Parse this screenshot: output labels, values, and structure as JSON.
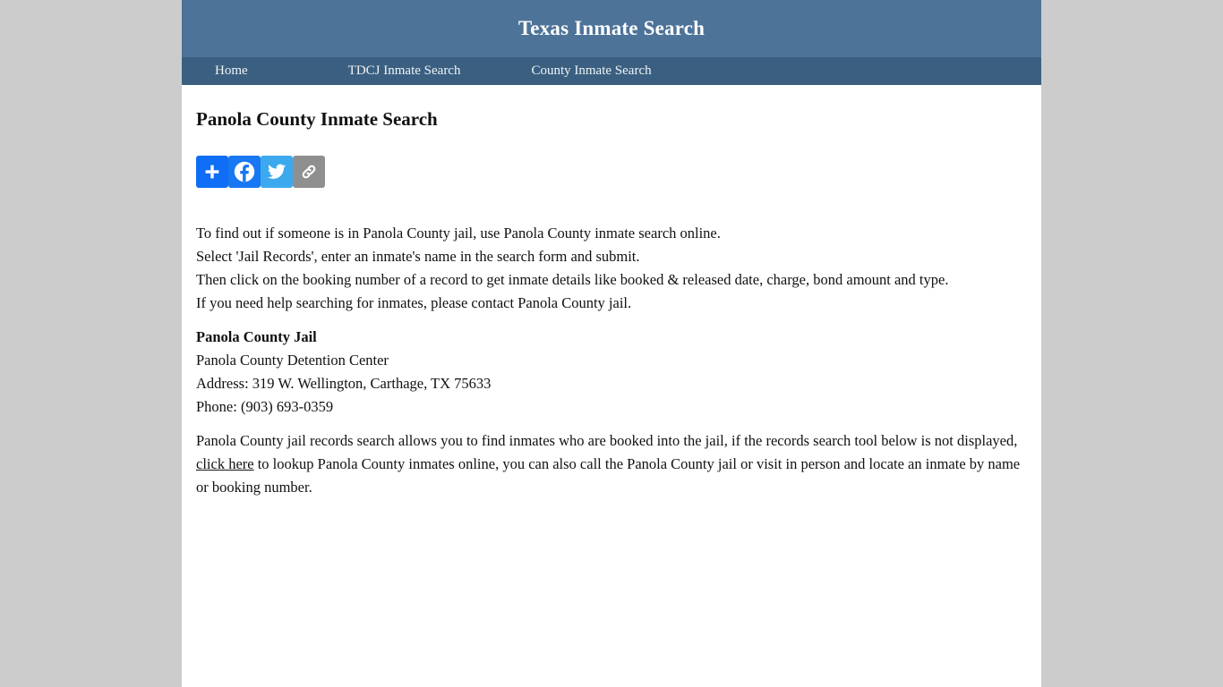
{
  "header": {
    "title": "Texas Inmate Search",
    "bg_color": "#4d7399"
  },
  "nav": {
    "bg_color": "#3b5f80",
    "items": [
      {
        "label": "Home"
      },
      {
        "label": "TDCJ Inmate Search"
      },
      {
        "label": "County Inmate Search"
      }
    ]
  },
  "main": {
    "page_title": "Panola County Inmate Search",
    "share_buttons": [
      {
        "name": "addthis-share-button",
        "icon": "plus-icon",
        "label": "Share",
        "color": "#0f6ef5"
      },
      {
        "name": "facebook-share-button",
        "icon": "facebook-icon",
        "label": "Facebook",
        "color": "#1877f2"
      },
      {
        "name": "twitter-share-button",
        "icon": "twitter-icon",
        "label": "Twitter",
        "color": "#3ca9ee"
      },
      {
        "name": "copy-link-share-button",
        "icon": "link-icon",
        "label": "Copy Link",
        "color": "#8f8f8f"
      }
    ],
    "instructions": [
      "To find out if someone is in Panola County jail, use Panola County inmate search online.",
      "Select 'Jail Records', enter an inmate's name in the search form and submit.",
      "Then click on the booking number of a record to get inmate details like booked & released date, charge, bond amount and type.",
      "If you need help searching for inmates, please contact Panola County jail."
    ],
    "jail_info": {
      "heading": "Panola County Jail",
      "facility": "Panola County Detention Center",
      "address": "Address: 319 W. Wellington, Carthage, TX 75633",
      "phone": "Phone: (903) 693-0359"
    },
    "closing_paragraph": {
      "part1": "Panola County jail records search allows you to find inmates who are booked into the jail, if the records search tool below is not displayed, ",
      "link_text": "click here",
      "part2": " to lookup Panola County inmates online, you can also call the Panola County jail or visit in person and locate an inmate by name or booking number."
    }
  }
}
